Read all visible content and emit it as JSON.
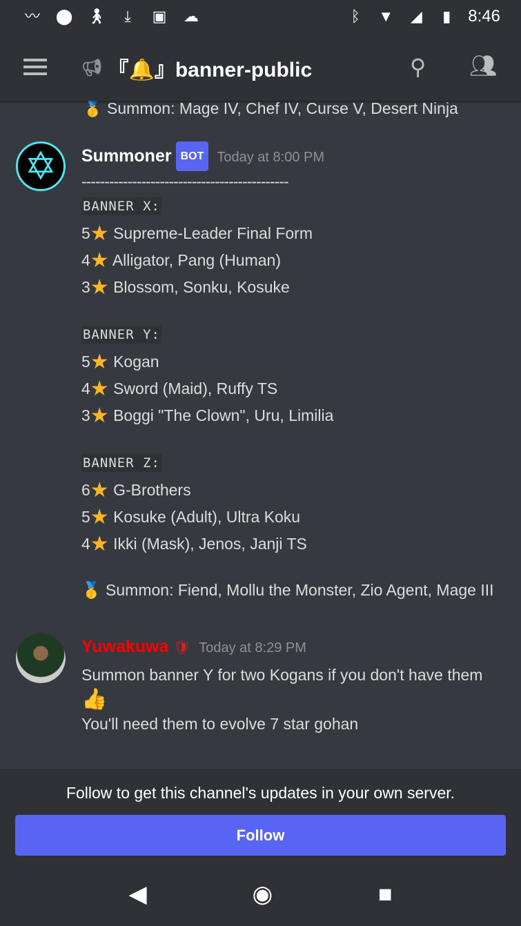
{
  "status_bar": {
    "time": "8:46",
    "icons": [
      "sperm-icon",
      "record-icon",
      "walk-icon",
      "download-icon",
      "image-icon",
      "cloud-icon",
      "bluetooth-icon",
      "wifi-icon",
      "signal-icon",
      "battery-charging-icon"
    ]
  },
  "header": {
    "channel_name": "『🔔』banner-public",
    "icons": [
      "menu-icon",
      "announcement-lock-icon",
      "search-icon",
      "members-icon"
    ]
  },
  "prev_line": "Summon: Mage IV, Chef IV, Curse V, Desert Ninja",
  "messages": [
    {
      "author": "Summoner",
      "badge": "BOT",
      "timestamp": "Today at 8:00 PM",
      "author_color": "#ffffff",
      "divider": "---------------------------------------------",
      "banners": [
        {
          "label": "BANNER X:",
          "lines": [
            {
              "n": "5",
              "text": "Supreme-Leader Final Form"
            },
            {
              "n": "4",
              "text": "Alligator, Pang (Human)"
            },
            {
              "n": "3",
              "text": "Blossom, Sonku, Kosuke"
            }
          ]
        },
        {
          "label": "BANNER Y:",
          "lines": [
            {
              "n": "5",
              "text": "Kogan"
            },
            {
              "n": "4",
              "text": "Sword (Maid), Ruffy TS"
            },
            {
              "n": "3",
              "text": "Boggi \"The Clown\", Uru, Limilia"
            }
          ]
        },
        {
          "label": "BANNER Z:",
          "lines": [
            {
              "n": "6",
              "text": "G-Brothers"
            },
            {
              "n": "5",
              "text": "Kosuke (Adult), Ultra Koku"
            },
            {
              "n": "4",
              "text": "Ikki (Mask), Jenos, Janji TS"
            }
          ]
        }
      ],
      "summon": "Summon: Fiend, Mollu the Monster, Zio Agent, Mage III"
    },
    {
      "author": "Yuwakuwa",
      "timestamp": "Today at 8:29 PM",
      "author_color": "#ff0000",
      "line1": "Summon banner Y for two Kogans if you don't have them",
      "emoji": "👍",
      "line2": "You'll need them to evolve 7 star gohan"
    }
  ],
  "footer": {
    "text": "Follow to get this channel's updates in your own server.",
    "button": "Follow",
    "accent": "#5865f2"
  }
}
